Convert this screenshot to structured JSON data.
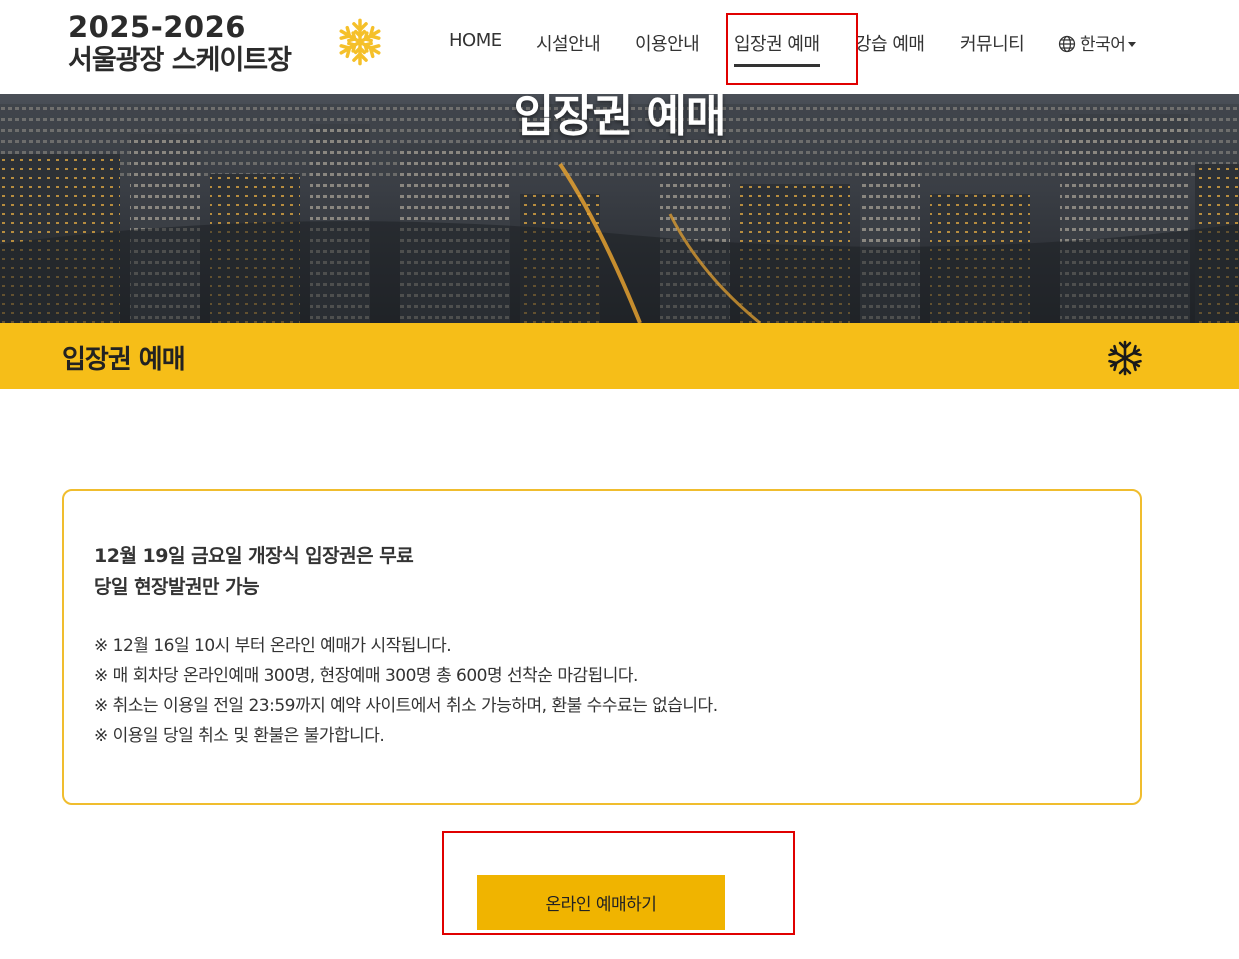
{
  "logo": {
    "line1": "2025-2026",
    "line2": "서울광장 스케이트장",
    "icon": "snowflake-icon",
    "icon_color": "#f5c02a"
  },
  "nav": {
    "items": [
      {
        "label": "HOME"
      },
      {
        "label": "시설안내"
      },
      {
        "label": "이용안내"
      },
      {
        "label": "입장권 예매",
        "active": true
      },
      {
        "label": "강습 예매"
      },
      {
        "label": "커뮤니티"
      }
    ],
    "language": {
      "label": "한국어",
      "icon": "globe-icon"
    }
  },
  "hero": {
    "title": "입장권 예매"
  },
  "page_bar": {
    "title": "입장권 예매",
    "icon": "snowflake-icon",
    "color": "#f6be18"
  },
  "notice": {
    "headline_1": "12월 19일 금요일 개장식 입장권은 무료",
    "headline_2": "당일 현장발권만 가능",
    "items": [
      "※ 12월 16일 10시 부터 온라인 예매가 시작됩니다.",
      "※ 매 회차당 온라인예매 300명, 현장예매 300명 총 600명 선착순 마감됩니다.",
      "※ 취소는 이용일 전일 23:59까지 예약 사이트에서 취소 가능하며, 환불 수수료는 없습니다.",
      "※ 이용일 당일 취소 및 환불은 불가합니다."
    ],
    "border_color": "#f0bd2e"
  },
  "cta": {
    "label": "온라인 예매하기",
    "color": "#f0b400"
  },
  "highlight_color": "#e00000"
}
